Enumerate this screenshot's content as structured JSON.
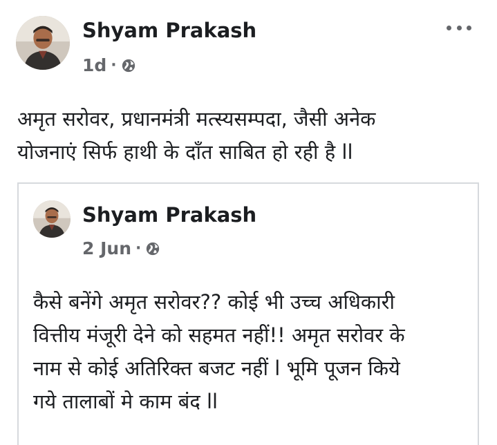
{
  "post": {
    "author": "Shyam Prakash",
    "time": "1d",
    "separator": "·",
    "text_lines": [
      "अमृत सरोवर, प्रधानमंत्री मत्स्यसम्पदा, जैसी  अनेक",
      "योजनाएं सिर्फ हाथी के दाँत साबित हो रही है ll"
    ]
  },
  "shared_post": {
    "author": "Shyam Prakash",
    "time": "2 Jun",
    "separator": "·",
    "text_lines": [
      "कैसे  बनेंगे अमृत सरोवर?? कोई भी उच्च अधिकारी",
      "वित्तीय मंजूरी देने को सहमत नहीं!!  अमृत सरोवर के",
      "नाम से कोई अतिरिक्त बजट नहीं l भूमि  पूजन किये",
      "गये तालाबों मे काम बंद ll"
    ]
  },
  "icons": {
    "audience": "globe-icon",
    "menu": "more-horizontal-icon"
  },
  "colors": {
    "text": "#1c1e21",
    "secondary": "#65676b",
    "border": "#d6d9dd"
  }
}
